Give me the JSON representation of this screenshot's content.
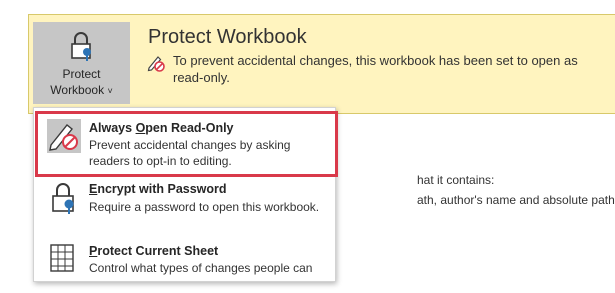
{
  "banner": {
    "button_line1": "Protect",
    "button_line2": "Workbook",
    "title": "Protect Workbook",
    "description": "To prevent accidental changes, this workbook has been set to open as read-only."
  },
  "background_text": {
    "line1": "hat it contains:",
    "line2": "ath, author's name and absolute path"
  },
  "menu": {
    "items": [
      {
        "title_pre": "Always ",
        "title_ul": "O",
        "title_post": "pen Read-Only",
        "description": "Prevent accidental changes by asking readers to opt-in to editing."
      },
      {
        "title_pre": "",
        "title_ul": "E",
        "title_post": "ncrypt with Password",
        "description": "Require a password to open this workbook."
      },
      {
        "title_pre": "",
        "title_ul": "P",
        "title_post": "rotect Current Sheet",
        "description": "Control what types of changes people can"
      }
    ]
  },
  "colors": {
    "banner_bg": "#fff4bf",
    "button_bg": "#c6c6c6",
    "highlight_border": "#d9394a"
  },
  "icons": {
    "button": "lock-key-icon",
    "banner": "pencil-no-icon",
    "item1": "pencil-no-icon",
    "item2": "lock-key-icon",
    "item3": "sheet-lock-icon"
  }
}
